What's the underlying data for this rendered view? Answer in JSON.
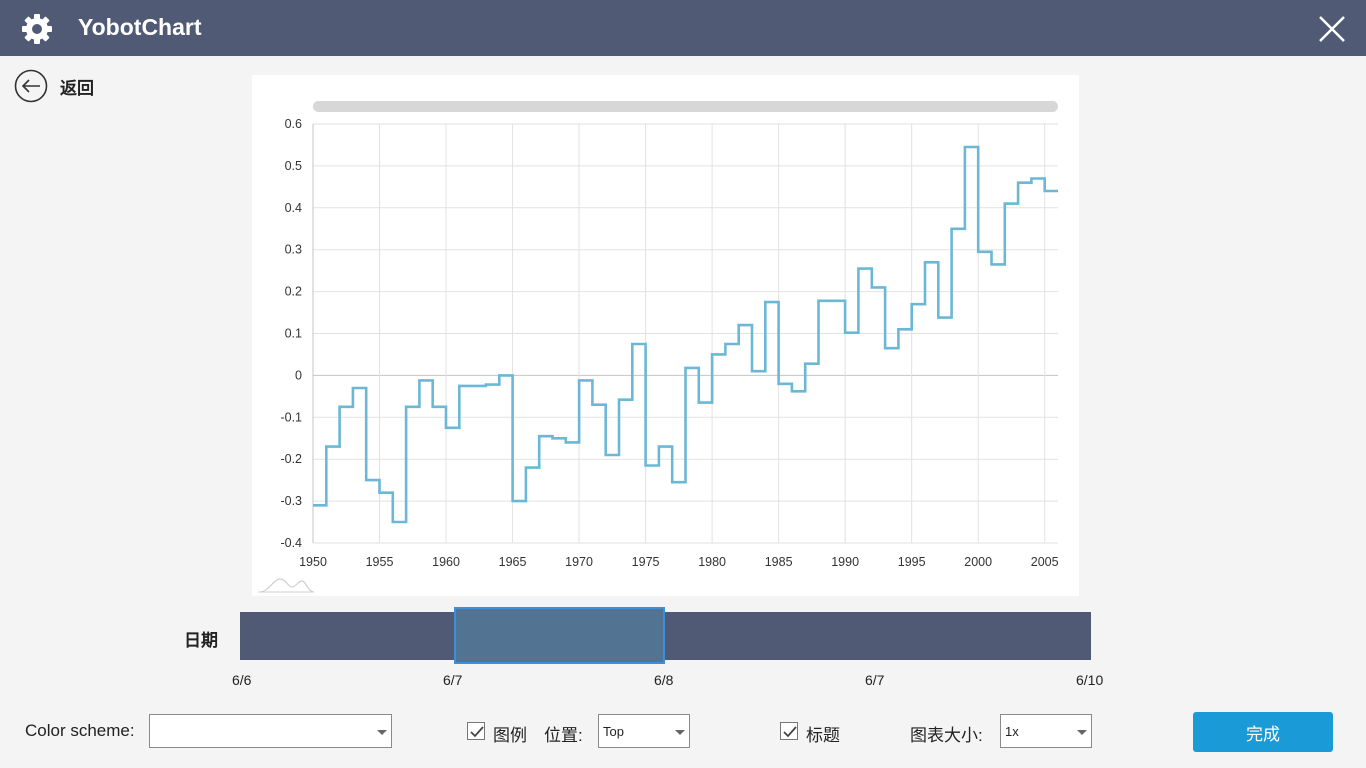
{
  "app": {
    "title": "YobotChart",
    "icon": "gear-icon",
    "close_icon": "close-icon"
  },
  "back": {
    "label": "返回",
    "icon": "arrow-left-circle-icon"
  },
  "chart_data": {
    "type": "line",
    "step": true,
    "x": [
      1950,
      1951,
      1952,
      1953,
      1954,
      1955,
      1956,
      1957,
      1958,
      1959,
      1960,
      1961,
      1962,
      1963,
      1964,
      1965,
      1966,
      1967,
      1968,
      1969,
      1970,
      1971,
      1972,
      1973,
      1974,
      1975,
      1976,
      1977,
      1978,
      1979,
      1980,
      1981,
      1982,
      1983,
      1984,
      1985,
      1986,
      1987,
      1988,
      1989,
      1990,
      1991,
      1992,
      1993,
      1994,
      1995,
      1996,
      1997,
      1998,
      1999,
      2000,
      2001,
      2002,
      2003,
      2004,
      2005
    ],
    "y": [
      -0.31,
      -0.17,
      -0.075,
      -0.03,
      -0.25,
      -0.28,
      -0.35,
      -0.075,
      -0.012,
      -0.075,
      -0.125,
      -0.025,
      -0.025,
      -0.022,
      0,
      -0.3,
      -0.22,
      -0.145,
      -0.15,
      -0.16,
      -0.012,
      -0.07,
      -0.19,
      -0.058,
      0.075,
      -0.215,
      -0.17,
      -0.255,
      0.018,
      -0.065,
      0.05,
      0.075,
      0.12,
      0.01,
      0.175,
      -0.02,
      -0.038,
      0.028,
      0.178,
      0.178,
      0.102,
      0.255,
      0.21,
      0.065,
      0.11,
      0.17,
      0.27,
      0.138,
      0.35,
      0.545,
      0.295,
      0.265,
      0.41,
      0.46,
      0.47,
      0.44,
      0.47
    ],
    "x_ticks": [
      "1950",
      "1955",
      "1960",
      "1965",
      "1970",
      "1975",
      "1980",
      "1985",
      "1990",
      "1995",
      "2000",
      "2005"
    ],
    "y_ticks": [
      "0.6",
      "0.5",
      "0.4",
      "0.3",
      "0.2",
      "0.1",
      "0",
      "-0.1",
      "-0.2",
      "-0.3",
      "-0.4"
    ],
    "xlim": [
      1950,
      2006
    ],
    "ylim": [
      -0.4,
      0.6
    ],
    "grid": true,
    "color": "#6bb8d6",
    "title": "",
    "xlabel": "",
    "ylabel": ""
  },
  "range": {
    "label": "日期",
    "ticks": [
      "6/6",
      "6/7",
      "6/8",
      "6/7",
      "6/10"
    ],
    "track_color": "#505a74",
    "selection_color": "#527392"
  },
  "controls": {
    "color_scheme_label": "Color scheme:",
    "color_scheme_value": "",
    "legend_label": "图例",
    "legend_checked": true,
    "position_label": "位置:",
    "position_value": "Top",
    "title_label": "标题",
    "title_checked": true,
    "size_label": "图表大小:",
    "size_value": "1x",
    "done_label": "完成"
  },
  "colors": {
    "titlebar": "#505a74",
    "accent": "#1a9ad6",
    "background": "#f4f4f4"
  }
}
